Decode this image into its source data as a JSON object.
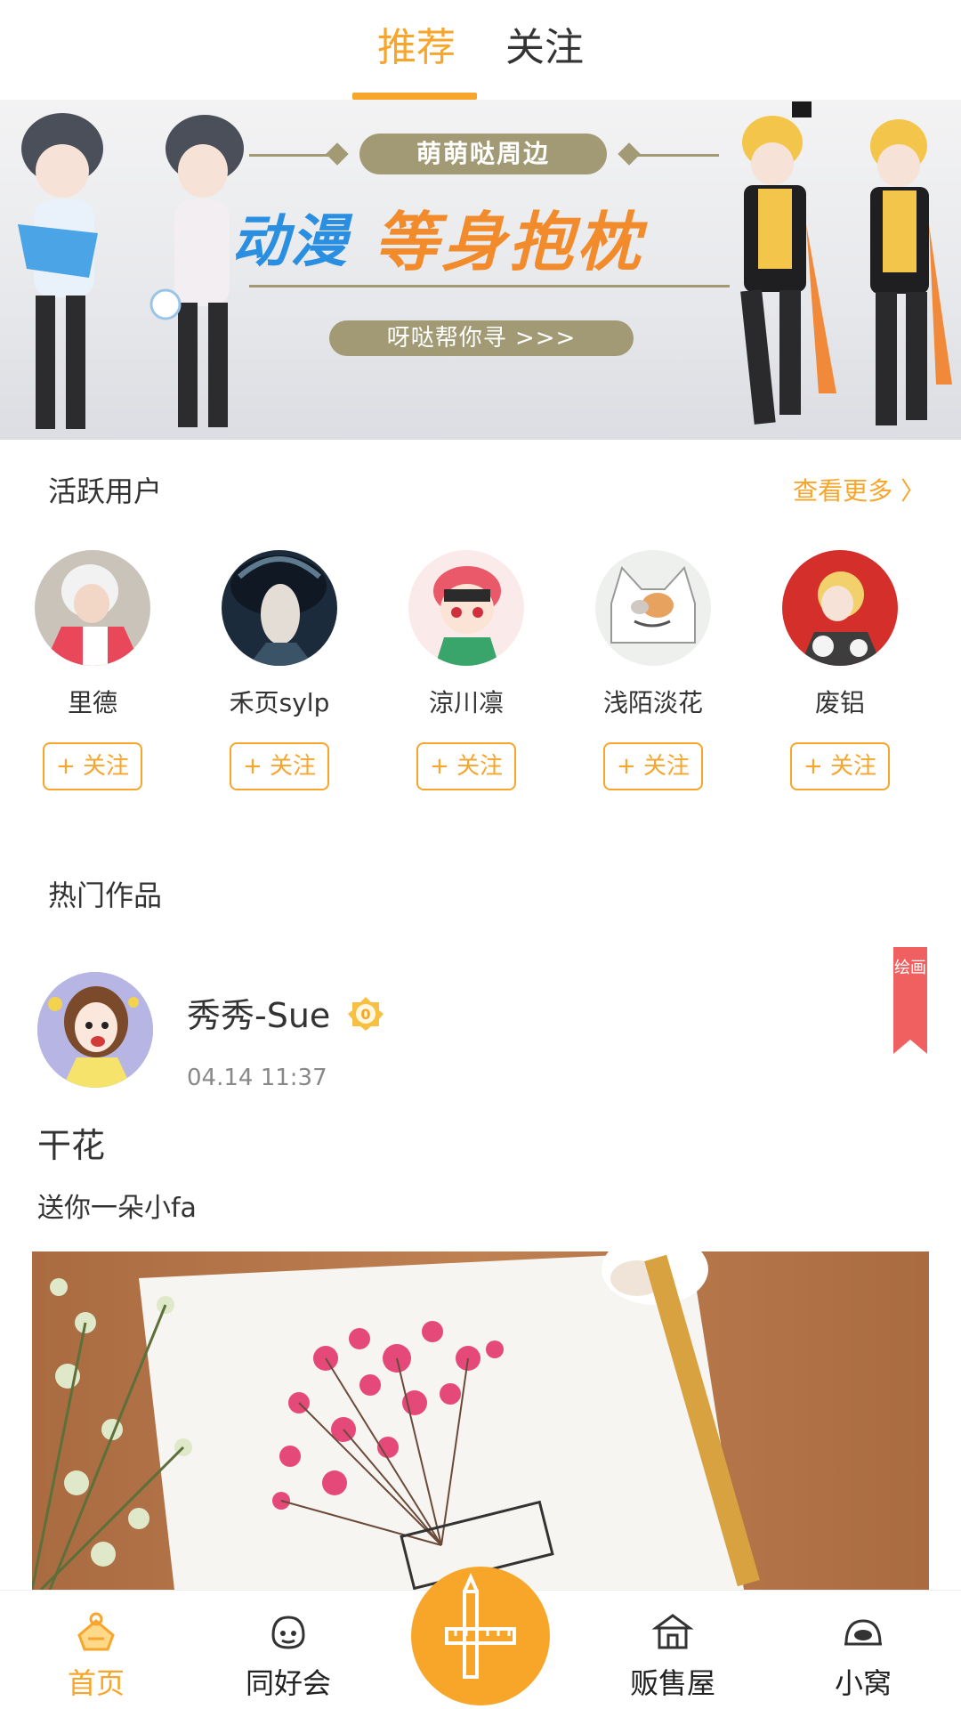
{
  "top_tabs": {
    "recommend": "推荐",
    "follow": "关注"
  },
  "banner": {
    "tag": "萌萌哒周边",
    "headline_a": "动漫",
    "headline_b": "等身抱枕",
    "cta": "呀哒帮你寻 >>>"
  },
  "active_users": {
    "title": "活跃用户",
    "more": "查看更多 〉",
    "follow_label": "+ 关注",
    "users": [
      {
        "name": "里德"
      },
      {
        "name": "禾页sylp"
      },
      {
        "name": "涼川凛"
      },
      {
        "name": "浅陌淡花"
      },
      {
        "name": "废铝"
      }
    ]
  },
  "hot_works": {
    "title": "热门作品",
    "post": {
      "author": "秀秀-Sue",
      "level": "0",
      "time": "04.14 11:37",
      "category": "绘画",
      "title": "干花",
      "description": "送你一朵小fa"
    }
  },
  "bottom_nav": {
    "items": [
      {
        "label": "首页",
        "icon": "home-icon"
      },
      {
        "label": "同好会",
        "icon": "club-icon"
      },
      {
        "label": "贩售屋",
        "icon": "shop-icon"
      },
      {
        "label": "小窝",
        "icon": "nest-icon"
      }
    ],
    "center_icon": "create-pencil-ruler-icon"
  },
  "colors": {
    "accent": "#f7a52b",
    "tag_red": "#f06060",
    "text": "#333333"
  }
}
